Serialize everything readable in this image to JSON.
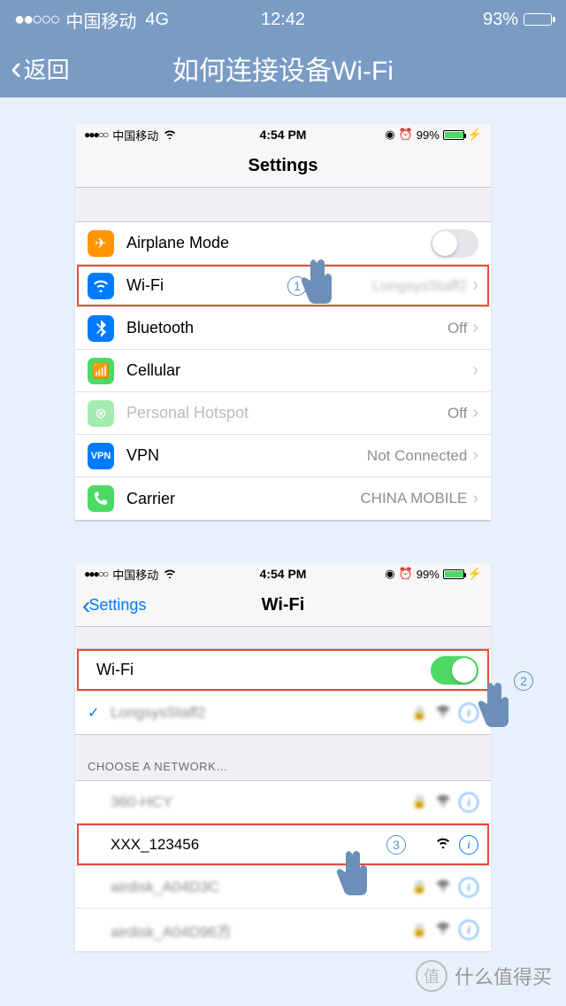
{
  "outer": {
    "carrier": "中国移动",
    "net": "4G",
    "time": "12:42",
    "batt": "93%",
    "back": "返回",
    "title": "如何连接设备Wi-Fi"
  },
  "shot1": {
    "bar": {
      "carrier": "中国移动",
      "time": "4:54 PM",
      "batt": "99%"
    },
    "title": "Settings",
    "rows": {
      "airplane": "Airplane Mode",
      "wifi": {
        "lbl": "Wi-Fi",
        "val": "LongsysStaff2"
      },
      "bt": {
        "lbl": "Bluetooth",
        "val": "Off"
      },
      "cell": "Cellular",
      "hot": {
        "lbl": "Personal Hotspot",
        "val": "Off"
      },
      "vpn": {
        "lbl": "VPN",
        "val": "Not Connected"
      },
      "carr": {
        "lbl": "Carrier",
        "val": "CHINA MOBILE"
      }
    },
    "step": "1"
  },
  "shot2": {
    "bar": {
      "carrier": "中国移动",
      "time": "4:54 PM",
      "batt": "99%"
    },
    "back": "Settings",
    "title": "Wi-Fi",
    "wifi_toggle": "Wi-Fi",
    "connected": "LongsysStaff2",
    "choose": "CHOOSE A NETWORK…",
    "nets": [
      "360-HCY",
      "XXX_123456",
      "airdisk_A04D3C",
      "airdisk_A04D96方"
    ],
    "step2": "2",
    "step3": "3"
  },
  "wm": {
    "icon": "值",
    "text": "什么值得买"
  }
}
